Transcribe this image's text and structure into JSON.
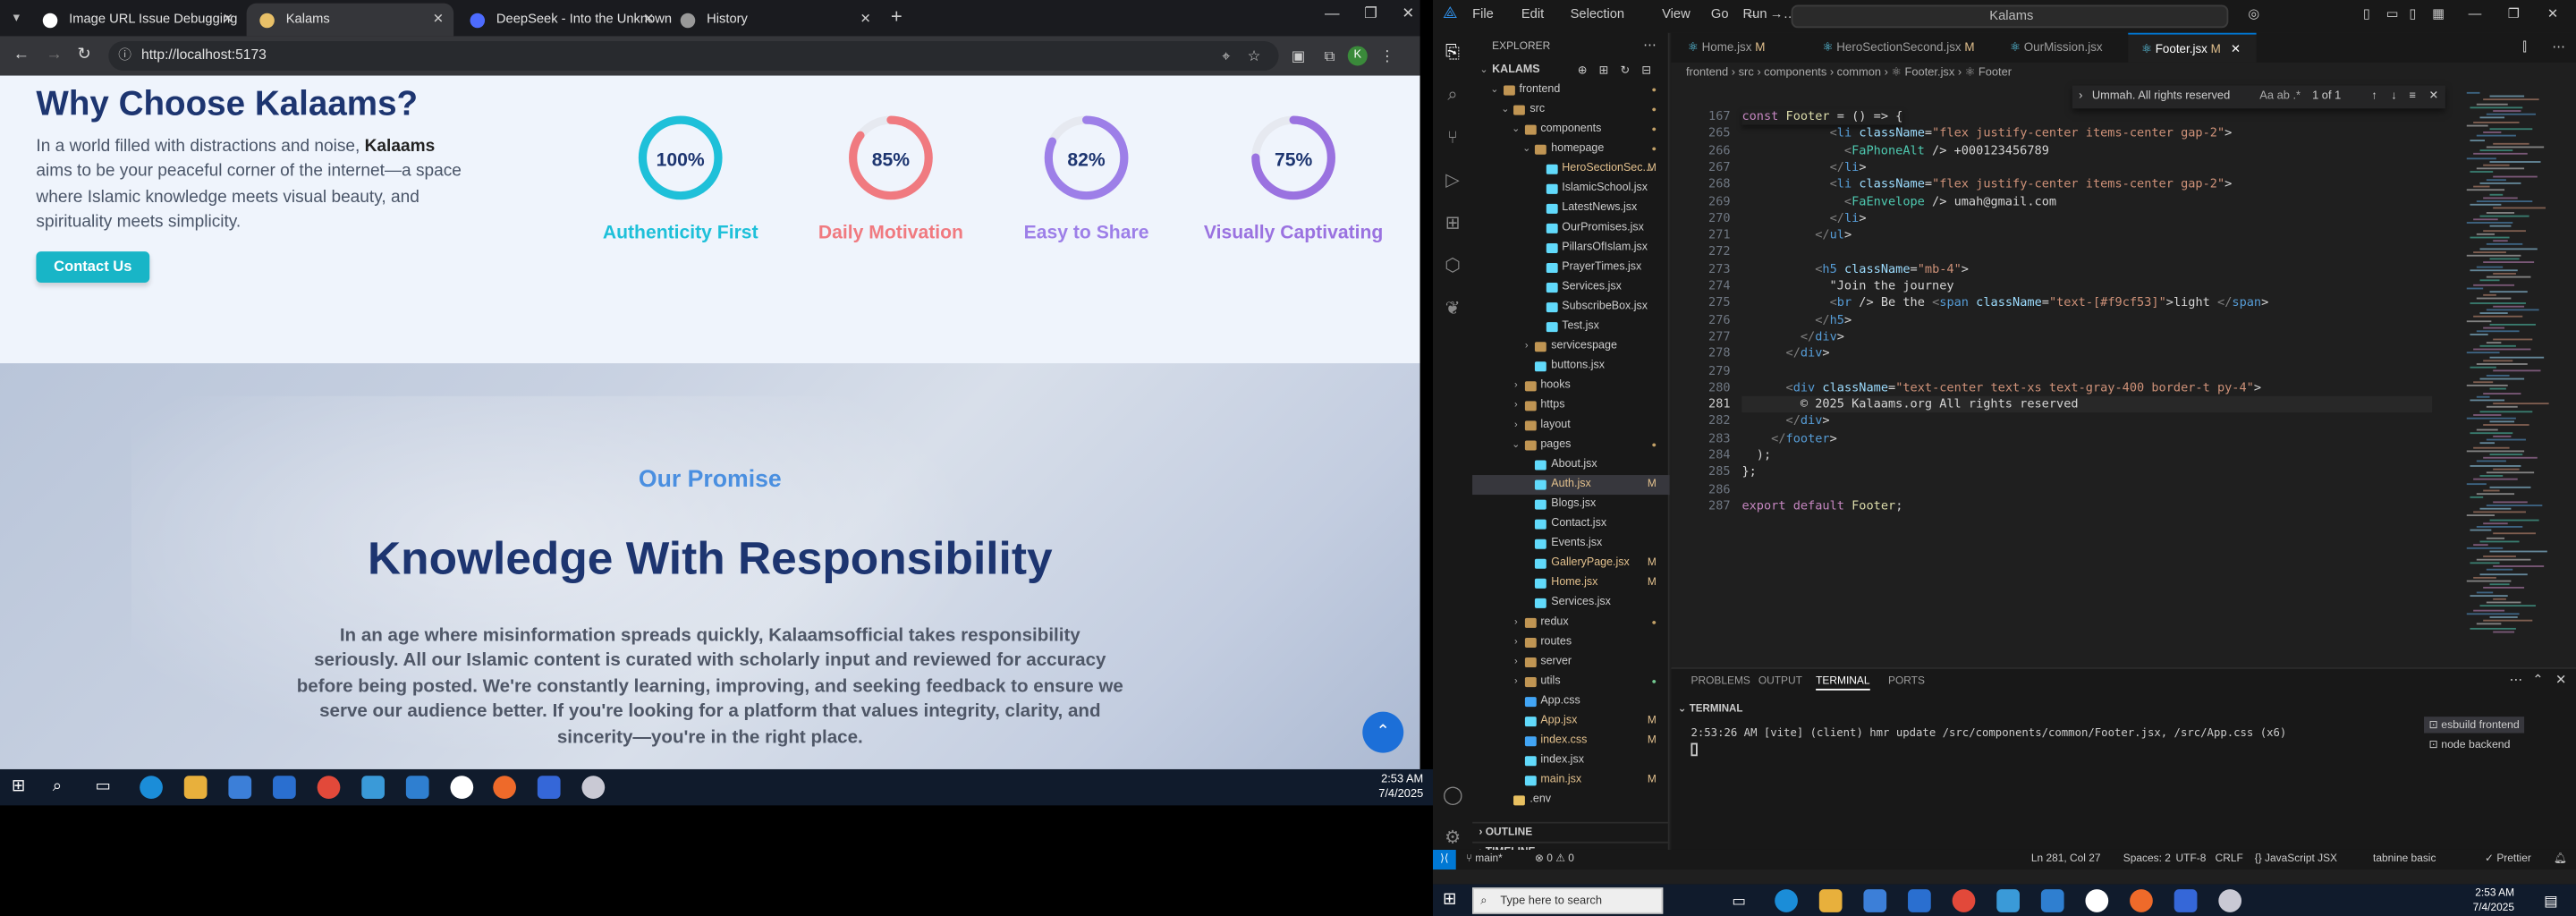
{
  "browser": {
    "tabs": [
      {
        "title": "Image URL Issue Debugging",
        "color": "#ffffff",
        "active": false
      },
      {
        "title": "Kalams",
        "color": "#e8c068",
        "active": true
      },
      {
        "title": "DeepSeek - Into the Unknown",
        "color": "#4d6bfe",
        "active": false
      },
      {
        "title": "History",
        "color": "#999999",
        "active": false
      }
    ],
    "url": "http://localhost:5173"
  },
  "why": {
    "title": "Why Choose Kalaams?",
    "text_pre": "In a world filled with distractions and noise, ",
    "text_bold": "Kalaams",
    "text_post": " aims to be your peaceful corner of the internet—a space where Islamic knowledge meets visual beauty, and spirituality meets simplicity.",
    "button": "Contact Us"
  },
  "stats": [
    {
      "value": 100,
      "pct": "100%",
      "label": "Authenticity First",
      "color": "#1ec0d9"
    },
    {
      "value": 85,
      "pct": "85%",
      "label": "Daily Motivation",
      "color": "#f07a80"
    },
    {
      "value": 82,
      "pct": "82%",
      "label": "Easy to Share",
      "color": "#9d7fe8"
    },
    {
      "value": 75,
      "pct": "75%",
      "label": "Visually Captivating",
      "color": "#9a72e0"
    }
  ],
  "promise": {
    "eyebrow": "Our Promise",
    "title": "Knowledge With Responsibility",
    "text": "In an age where misinformation spreads quickly, Kalaamsofficial takes responsibility seriously. All our Islamic content is curated with scholarly input and reviewed for accuracy before being posted. We're constantly learning, improving, and seeking feedback to ensure we serve our audience better. If you're looking for a platform that values integrity, clarity, and sincerity—you're in the right place."
  },
  "taskbar_left": {
    "time": "2:53 AM",
    "date": "7/4/2025"
  },
  "vscode": {
    "menu": [
      "File",
      "Edit",
      "Selection",
      "View",
      "Go",
      "Run",
      "…"
    ],
    "command_center": "Kalams",
    "explorer_title": "EXPLORER",
    "tree": [
      {
        "name": "KALAMS",
        "depth": 0,
        "kind": "root",
        "arrow": "⌄",
        "status": ""
      },
      {
        "name": "frontend",
        "depth": 1,
        "kind": "folder",
        "arrow": "⌄",
        "status": "dot"
      },
      {
        "name": "src",
        "depth": 2,
        "kind": "folder",
        "arrow": "⌄",
        "status": "dot"
      },
      {
        "name": "components",
        "depth": 3,
        "kind": "folder",
        "arrow": "⌄",
        "status": "dot"
      },
      {
        "name": "homepage",
        "depth": 4,
        "kind": "folder",
        "arrow": "⌄",
        "status": "dot"
      },
      {
        "name": "HeroSectionSec...",
        "depth": 5,
        "kind": "jsx",
        "arrow": "",
        "status": "M"
      },
      {
        "name": "IslamicSchool.jsx",
        "depth": 5,
        "kind": "jsx",
        "arrow": "",
        "status": ""
      },
      {
        "name": "LatestNews.jsx",
        "depth": 5,
        "kind": "jsx",
        "arrow": "",
        "status": ""
      },
      {
        "name": "OurPromises.jsx",
        "depth": 5,
        "kind": "jsx",
        "arrow": "",
        "status": ""
      },
      {
        "name": "PillarsOfIslam.jsx",
        "depth": 5,
        "kind": "jsx",
        "arrow": "",
        "status": ""
      },
      {
        "name": "PrayerTimes.jsx",
        "depth": 5,
        "kind": "jsx",
        "arrow": "",
        "status": ""
      },
      {
        "name": "Services.jsx",
        "depth": 5,
        "kind": "jsx",
        "arrow": "",
        "status": ""
      },
      {
        "name": "SubscribeBox.jsx",
        "depth": 5,
        "kind": "jsx",
        "arrow": "",
        "status": ""
      },
      {
        "name": "Test.jsx",
        "depth": 5,
        "kind": "jsx",
        "arrow": "",
        "status": ""
      },
      {
        "name": "servicespage",
        "depth": 4,
        "kind": "folder",
        "arrow": "›",
        "status": ""
      },
      {
        "name": "buttons.jsx",
        "depth": 4,
        "kind": "jsx",
        "arrow": "",
        "status": ""
      },
      {
        "name": "hooks",
        "depth": 3,
        "kind": "folder",
        "arrow": "›",
        "status": ""
      },
      {
        "name": "https",
        "depth": 3,
        "kind": "folder",
        "arrow": "›",
        "status": ""
      },
      {
        "name": "layout",
        "depth": 3,
        "kind": "folder",
        "arrow": "›",
        "status": ""
      },
      {
        "name": "pages",
        "depth": 3,
        "kind": "folder",
        "arrow": "⌄",
        "status": "dot"
      },
      {
        "name": "About.jsx",
        "depth": 4,
        "kind": "jsx",
        "arrow": "",
        "status": ""
      },
      {
        "name": "Auth.jsx",
        "depth": 4,
        "kind": "jsx",
        "arrow": "",
        "status": "M",
        "selected": true
      },
      {
        "name": "Blogs.jsx",
        "depth": 4,
        "kind": "jsx",
        "arrow": "",
        "status": ""
      },
      {
        "name": "Contact.jsx",
        "depth": 4,
        "kind": "jsx",
        "arrow": "",
        "status": ""
      },
      {
        "name": "Events.jsx",
        "depth": 4,
        "kind": "jsx",
        "arrow": "",
        "status": ""
      },
      {
        "name": "GalleryPage.jsx",
        "depth": 4,
        "kind": "jsx",
        "arrow": "",
        "status": "M"
      },
      {
        "name": "Home.jsx",
        "depth": 4,
        "kind": "jsx",
        "arrow": "",
        "status": "M"
      },
      {
        "name": "Services.jsx",
        "depth": 4,
        "kind": "jsx",
        "arrow": "",
        "status": ""
      },
      {
        "name": "redux",
        "depth": 3,
        "kind": "folder",
        "arrow": "›",
        "status": "dot"
      },
      {
        "name": "routes",
        "depth": 3,
        "kind": "folder",
        "arrow": "›",
        "status": ""
      },
      {
        "name": "server",
        "depth": 3,
        "kind": "folder",
        "arrow": "›",
        "status": ""
      },
      {
        "name": "utils",
        "depth": 3,
        "kind": "folder",
        "arrow": "›",
        "status": "dotg"
      },
      {
        "name": "App.css",
        "depth": 3,
        "kind": "css",
        "arrow": "",
        "status": ""
      },
      {
        "name": "App.jsx",
        "depth": 3,
        "kind": "jsx",
        "arrow": "",
        "status": "M"
      },
      {
        "name": "index.css",
        "depth": 3,
        "kind": "css",
        "arrow": "",
        "status": "M"
      },
      {
        "name": "index.jsx",
        "depth": 3,
        "kind": "jsx",
        "arrow": "",
        "status": ""
      },
      {
        "name": "main.jsx",
        "depth": 3,
        "kind": "jsx",
        "arrow": "",
        "status": "M"
      },
      {
        "name": ".env",
        "depth": 2,
        "kind": "env",
        "arrow": "",
        "status": ""
      }
    ],
    "sections": [
      "OUTLINE",
      "TIMELINE"
    ],
    "editor_tabs": [
      {
        "name": "Home.jsx",
        "mod": "M",
        "active": false
      },
      {
        "name": "HeroSectionSecond.jsx",
        "mod": "M",
        "active": false
      },
      {
        "name": "OurMission.jsx",
        "mod": "",
        "active": false
      },
      {
        "name": "Footer.jsx",
        "mod": "M",
        "active": true
      }
    ],
    "breadcrumb": "frontend › src › components › common › ⚛ Footer.jsx › ⚛ Footer",
    "find": {
      "query": "Ummah. All rights reserved",
      "opts": "Aa ab .*",
      "count": "1 of 1"
    },
    "code": [
      {
        "n": "167",
        "t": "const Footer = () => {"
      },
      {
        "n": "265",
        "t": "            <li className=\"flex justify-center items-center gap-2\">"
      },
      {
        "n": "266",
        "t": "              <FaPhoneAlt /> +000123456789"
      },
      {
        "n": "267",
        "t": "            </li>"
      },
      {
        "n": "268",
        "t": "            <li className=\"flex justify-center items-center gap-2\">"
      },
      {
        "n": "269",
        "t": "              <FaEnvelope /> umah@gmail.com"
      },
      {
        "n": "270",
        "t": "            </li>"
      },
      {
        "n": "271",
        "t": "          </ul>"
      },
      {
        "n": "272",
        "t": ""
      },
      {
        "n": "273",
        "t": "          <h5 className=\"mb-4\">"
      },
      {
        "n": "274",
        "t": "            \"Join the journey"
      },
      {
        "n": "275",
        "t": "            <br /> Be the <span className=\"text-[#f9cf53]\">light </span>"
      },
      {
        "n": "276",
        "t": "          </h5>"
      },
      {
        "n": "277",
        "t": "        </div>"
      },
      {
        "n": "278",
        "t": "      </div>"
      },
      {
        "n": "279",
        "t": ""
      },
      {
        "n": "280",
        "t": "      <div className=\"text-center text-xs text-gray-400 border-t py-4\">"
      },
      {
        "n": "281",
        "t": "        © 2025 Kalaams.org All rights reserved"
      },
      {
        "n": "282",
        "t": "      </div>"
      },
      {
        "n": "283",
        "t": "    </footer>"
      },
      {
        "n": "284",
        "t": "  );"
      },
      {
        "n": "285",
        "t": "};"
      },
      {
        "n": "286",
        "t": ""
      },
      {
        "n": "287",
        "t": "export default Footer;"
      }
    ],
    "panel_tabs": [
      "PROBLEMS",
      "OUTPUT",
      "TERMINAL",
      "PORTS"
    ],
    "terminal_title": "TERMINAL",
    "terminal_line": "2:53:26 AM [vite] (client) hmr update /src/components/common/Footer.jsx, /src/App.css (x6)",
    "terminals": [
      "esbuild frontend",
      "node backend"
    ],
    "status": {
      "branch": "main*",
      "errors": "⊗ 0 ⚠ 0",
      "cursor": "Ln 281, Col 27",
      "spaces": "Spaces: 2",
      "enc": "UTF-8",
      "eol": "CRLF",
      "lang": "{} JavaScript JSX",
      "tabnine": "tabnine basic",
      "prettier": "✓ Prettier"
    },
    "taskbar": {
      "search": "Type here to search",
      "time": "2:53 AM",
      "date": "7/4/2025"
    }
  }
}
